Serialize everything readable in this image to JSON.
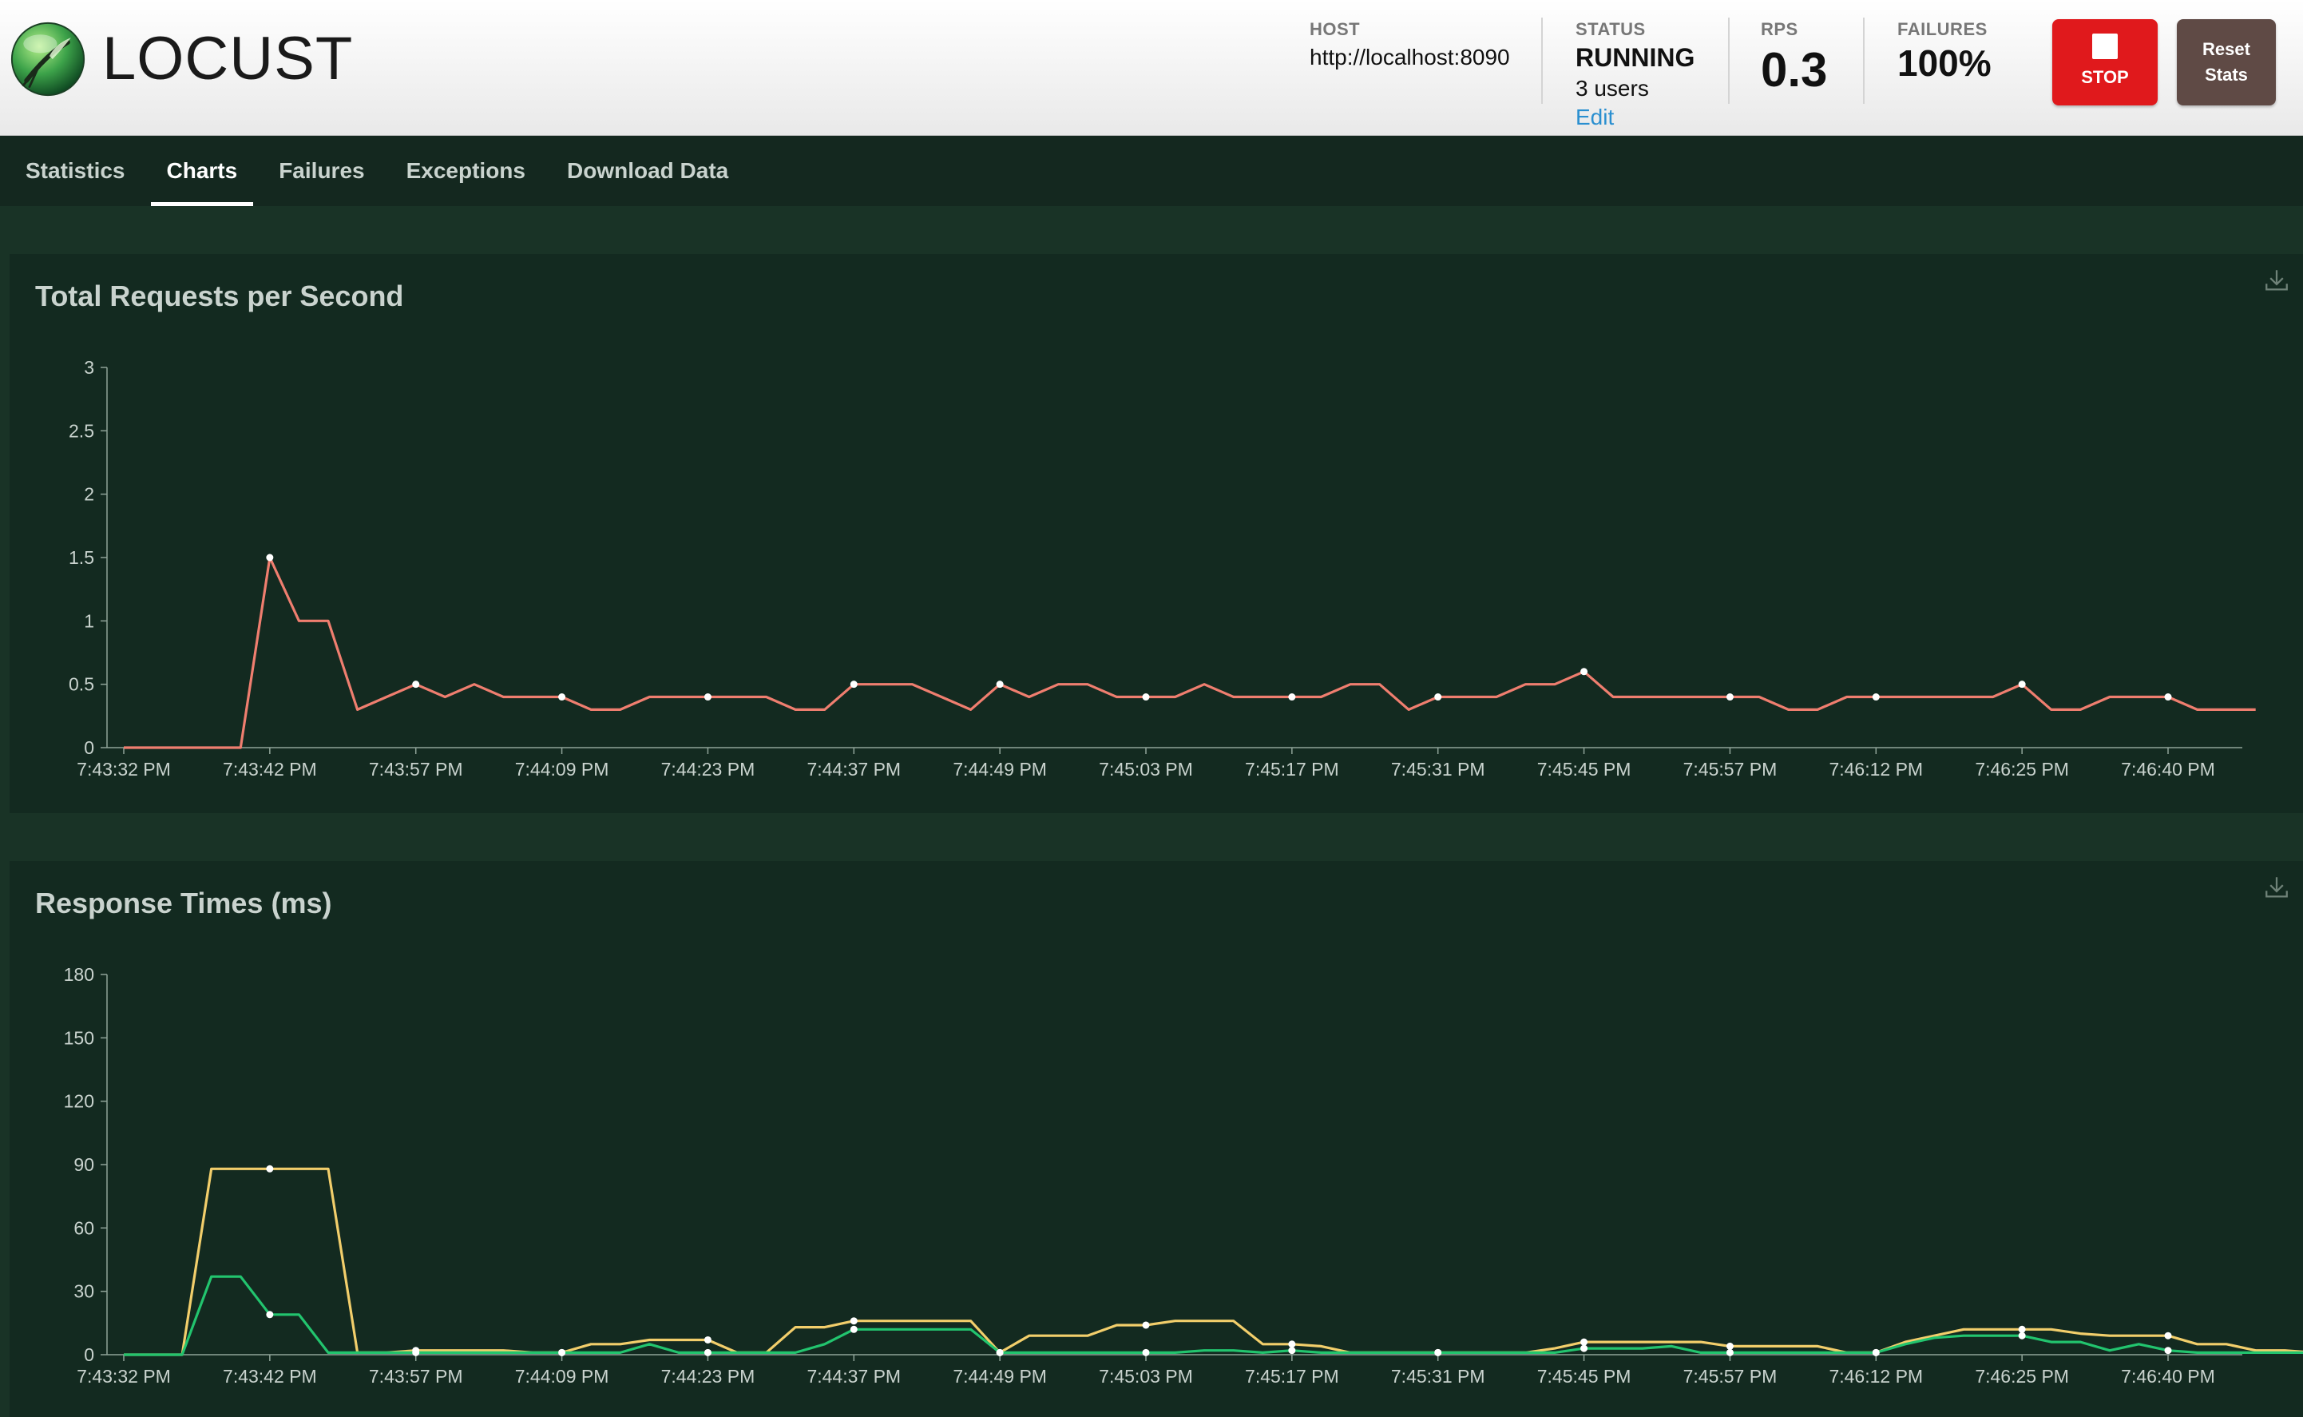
{
  "app": {
    "name": "LOCUST"
  },
  "header": {
    "host_label": "HOST",
    "host_value": "http://localhost:8090",
    "status_label": "STATUS",
    "status_value": "RUNNING",
    "users_value": "3 users",
    "edit_label": "Edit",
    "rps_label": "RPS",
    "rps_value": "0.3",
    "failures_label": "FAILURES",
    "failures_value": "100%",
    "stop_label": "STOP",
    "reset_label_1": "Reset",
    "reset_label_2": "Stats"
  },
  "tabs": [
    {
      "label": "Statistics",
      "active": false
    },
    {
      "label": "Charts",
      "active": true
    },
    {
      "label": "Failures",
      "active": false
    },
    {
      "label": "Exceptions",
      "active": false
    },
    {
      "label": "Download Data",
      "active": false
    }
  ],
  "colors": {
    "rps_line": "#ef7e6f",
    "yellow_line": "#f2ce6b",
    "green_line": "#22c46e",
    "axis": "#8fa398"
  },
  "chart_data": [
    {
      "type": "line",
      "title": "Total Requests per Second",
      "ylim": [
        0,
        3
      ],
      "yticks": [
        "0",
        "0.5",
        "1",
        "1.5",
        "2",
        "2.5",
        "3"
      ],
      "xtick_labels": [
        "7:43:32 PM",
        "7:43:42 PM",
        "7:43:57 PM",
        "7:44:09 PM",
        "7:44:23 PM",
        "7:44:37 PM",
        "7:44:49 PM",
        "7:45:03 PM",
        "7:45:17 PM",
        "7:45:31 PM",
        "7:45:45 PM",
        "7:45:57 PM",
        "7:46:12 PM",
        "7:46:25 PM",
        "7:46:40 PM"
      ],
      "series": [
        {
          "color_key": "rps_line",
          "values": [
            0,
            0,
            0,
            0,
            0,
            1.5,
            1,
            1,
            0.3,
            0.4,
            0.5,
            0.4,
            0.5,
            0.4,
            0.4,
            0.4,
            0.3,
            0.3,
            0.4,
            0.4,
            0.4,
            0.4,
            0.4,
            0.3,
            0.3,
            0.5,
            0.5,
            0.5,
            0.4,
            0.3,
            0.5,
            0.4,
            0.5,
            0.5,
            0.4,
            0.4,
            0.4,
            0.5,
            0.4,
            0.4,
            0.4,
            0.4,
            0.5,
            0.5,
            0.3,
            0.4,
            0.4,
            0.4,
            0.5,
            0.5,
            0.6,
            0.4,
            0.4,
            0.4,
            0.4,
            0.4,
            0.4,
            0.3,
            0.3,
            0.4,
            0.4,
            0.4,
            0.4,
            0.4,
            0.4,
            0.5,
            0.3,
            0.3,
            0.4,
            0.4,
            0.4,
            0.3,
            0.3,
            0.3
          ]
        }
      ]
    },
    {
      "type": "line",
      "title": "Response Times (ms)",
      "ylim": [
        0,
        180
      ],
      "yticks": [
        "0",
        "30",
        "60",
        "90",
        "120",
        "150",
        "180"
      ],
      "xtick_labels": [
        "7:43:32 PM",
        "7:43:42 PM",
        "7:43:57 PM",
        "7:44:09 PM",
        "7:44:23 PM",
        "7:44:37 PM",
        "7:44:49 PM",
        "7:45:03 PM",
        "7:45:17 PM",
        "7:45:31 PM",
        "7:45:45 PM",
        "7:45:57 PM",
        "7:46:12 PM",
        "7:46:25 PM",
        "7:46:40 PM"
      ],
      "series": [
        {
          "color_key": "yellow_line",
          "values": [
            0,
            0,
            0,
            88,
            88,
            88,
            88,
            88,
            1,
            1,
            2,
            2,
            2,
            2,
            1,
            1,
            5,
            5,
            7,
            7,
            7,
            1,
            1,
            13,
            13,
            16,
            16,
            16,
            16,
            16,
            1,
            9,
            9,
            9,
            14,
            14,
            16,
            16,
            16,
            5,
            5,
            4,
            1,
            1,
            1,
            1,
            1,
            1,
            1,
            3,
            6,
            6,
            6,
            6,
            6,
            4,
            4,
            4,
            4,
            1,
            1,
            6,
            9,
            12,
            12,
            12,
            12,
            10,
            9,
            9,
            9,
            5,
            5,
            2,
            2,
            1
          ]
        },
        {
          "color_key": "green_line",
          "values": [
            0,
            0,
            0,
            37,
            37,
            19,
            19,
            1,
            1,
            1,
            1,
            1,
            1,
            1,
            1,
            1,
            1,
            1,
            5,
            1,
            1,
            1,
            1,
            1,
            5,
            12,
            12,
            12,
            12,
            12,
            1,
            1,
            1,
            1,
            1,
            1,
            1,
            2,
            2,
            1,
            2,
            1,
            1,
            1,
            1,
            1,
            1,
            1,
            1,
            1,
            3,
            3,
            3,
            4,
            1,
            1,
            1,
            1,
            1,
            1,
            1,
            5,
            8,
            9,
            9,
            9,
            6,
            6,
            2,
            5,
            2,
            1,
            1,
            1,
            1,
            1
          ]
        }
      ]
    }
  ]
}
